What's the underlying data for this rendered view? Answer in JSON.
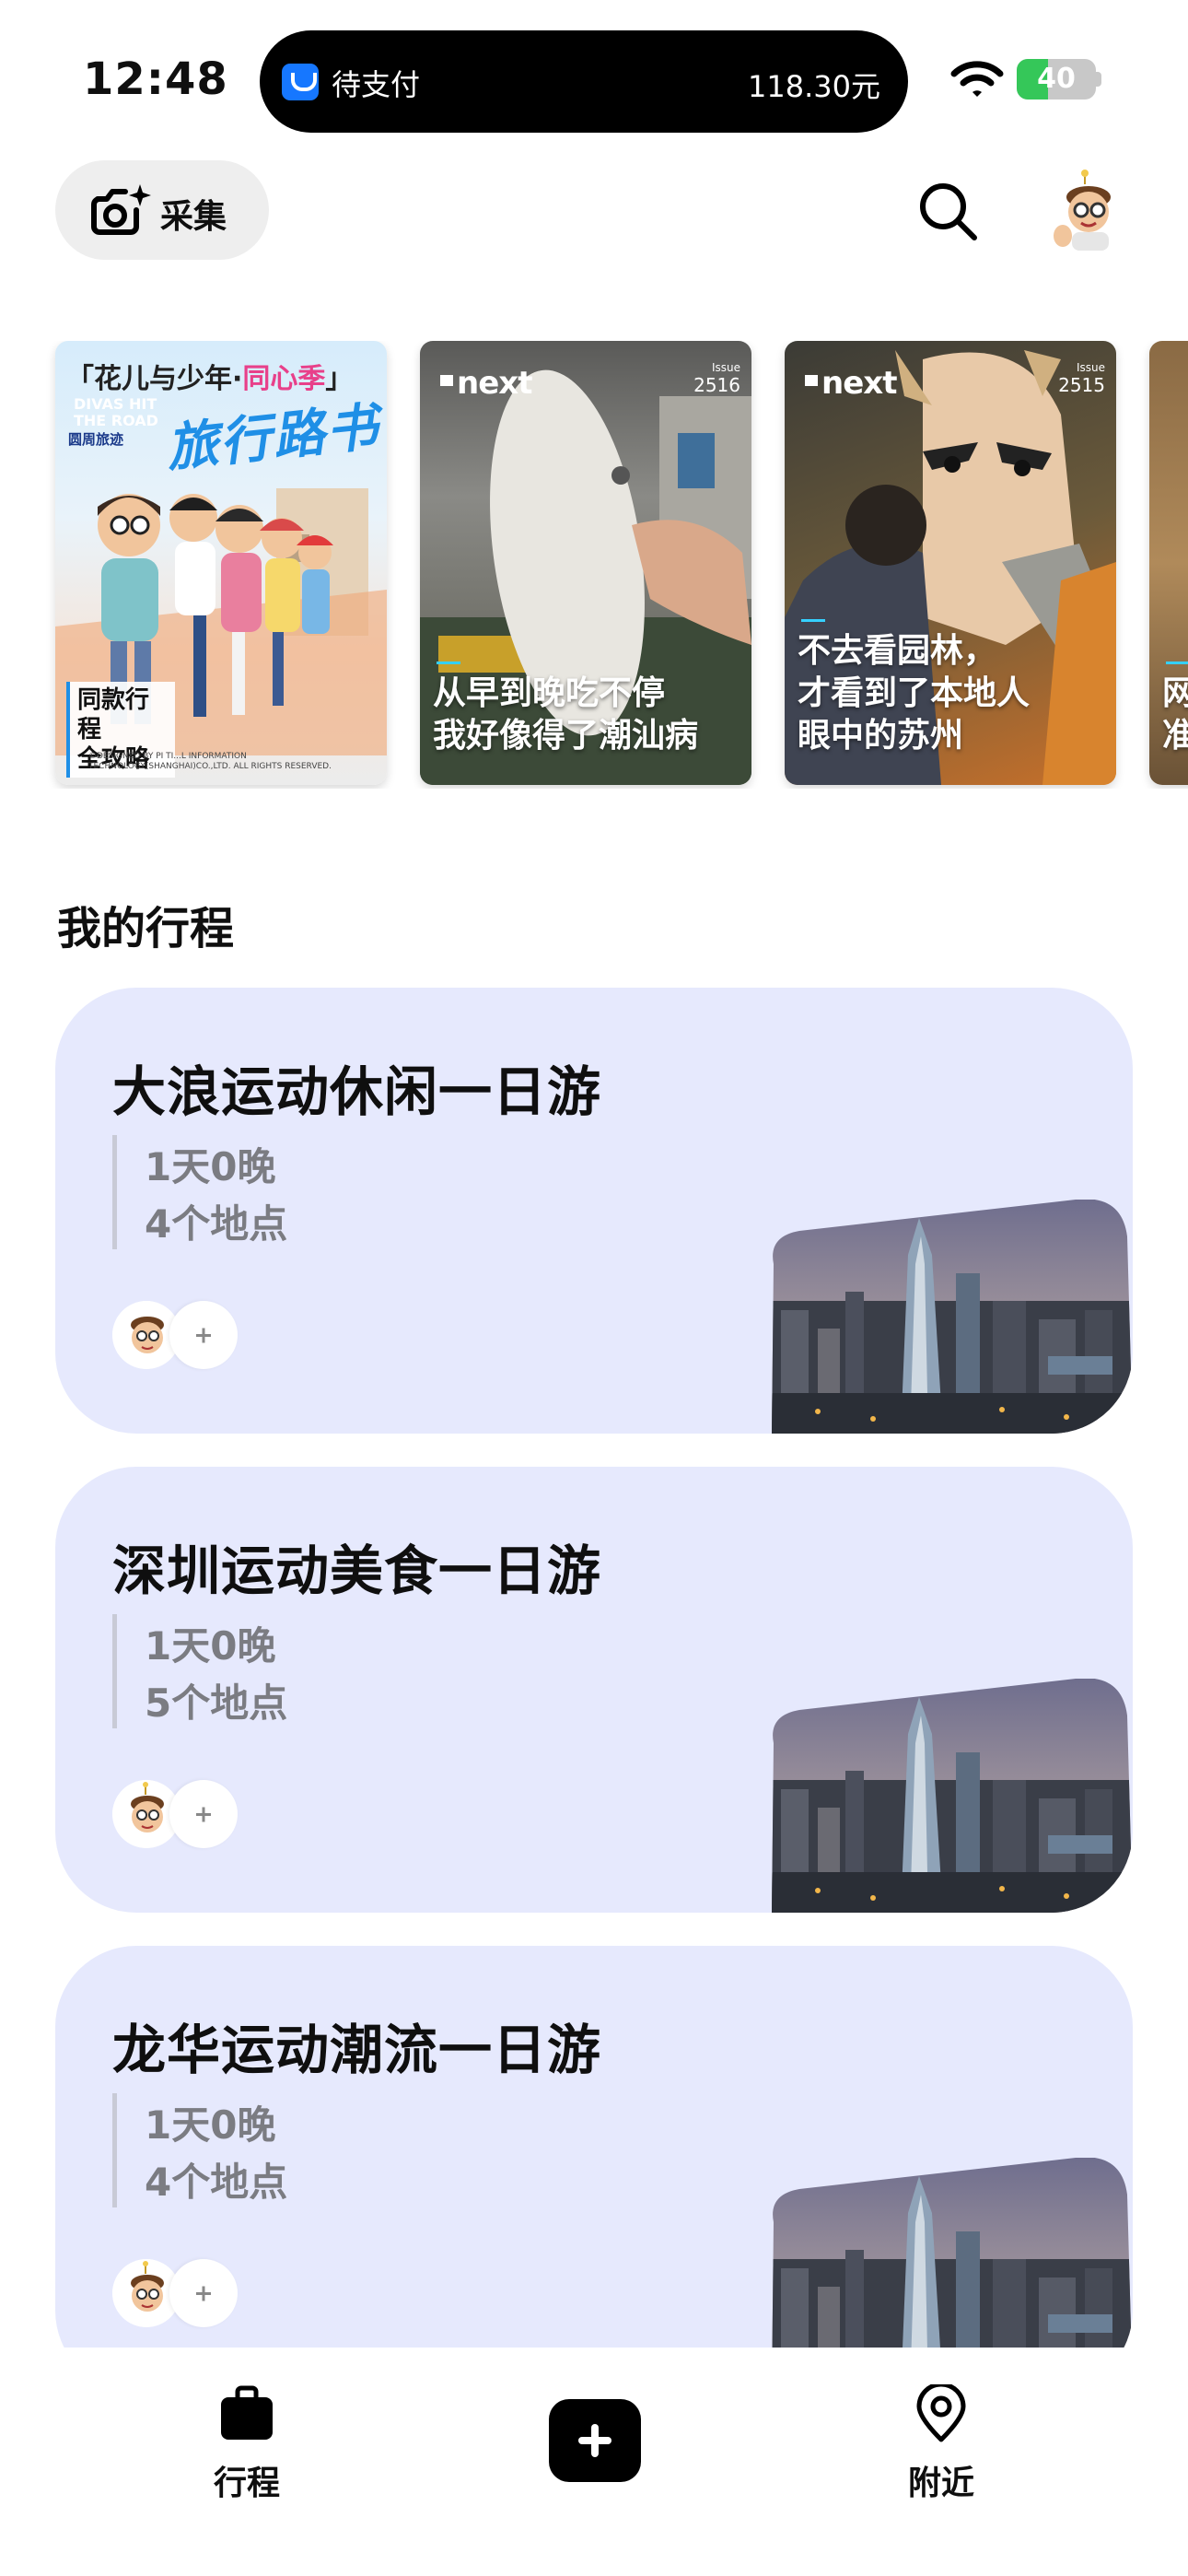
{
  "status_bar": {
    "time": "12:48",
    "live_activity": {
      "label": "待支付",
      "amount": "118.30元"
    },
    "battery_level": "40"
  },
  "header": {
    "collect_label": "采集",
    "icons": [
      "camera-sparkle-icon",
      "search-icon",
      "avatar"
    ]
  },
  "magazines": [
    {
      "type": "ad",
      "title_prefix": "「花儿与少年·",
      "title_highlight": "同心季",
      "title_suffix": "」",
      "sub_line1": "DIVAS HIT",
      "sub_line2": "THE ROAD",
      "brand": "圆周旅迹",
      "script": "旅行路书",
      "tag_line1": "同款行程",
      "tag_line2": "全攻略",
      "copyright": "©DESIGNED BY PI TI...L INFORMATION TECHNOLOGY(SHANGHAI)CO.,LTD. ALL RIGHTS RESERVED."
    },
    {
      "type": "next",
      "brand": "next",
      "issue_label": "Issue",
      "issue": "2516",
      "title_line1": "从早到晚吃不停",
      "title_line2": "我好像得了潮汕病"
    },
    {
      "type": "next",
      "brand": "next",
      "issue_label": "Issue",
      "issue": "2515",
      "title_line1": "不去看园林，",
      "title_line2": "才看到了本地人",
      "title_line3": "眼中的苏州"
    },
    {
      "type": "next",
      "title_line1": "网",
      "title_line2": "准"
    }
  ],
  "section": {
    "title": "我的行程"
  },
  "trips": [
    {
      "title": "大浪运动休闲一日游",
      "duration": "1天0晚",
      "places": "4个地点"
    },
    {
      "title": "深圳运动美食一日游",
      "duration": "1天0晚",
      "places": "5个地点"
    },
    {
      "title": "龙华运动潮流一日游",
      "duration": "1天0晚",
      "places": "4个地点"
    }
  ],
  "tabbar": {
    "items": [
      {
        "label": "行程",
        "icon": "briefcase-icon"
      },
      {
        "label": "",
        "icon": "plus-icon"
      },
      {
        "label": "附近",
        "icon": "location-pin-icon"
      }
    ]
  },
  "colors": {
    "trip_card_bg": "#e6e9fd",
    "battery_fill": "#35c759",
    "highlight_pink": "#e8408a",
    "script_blue": "#1f8fe6"
  }
}
